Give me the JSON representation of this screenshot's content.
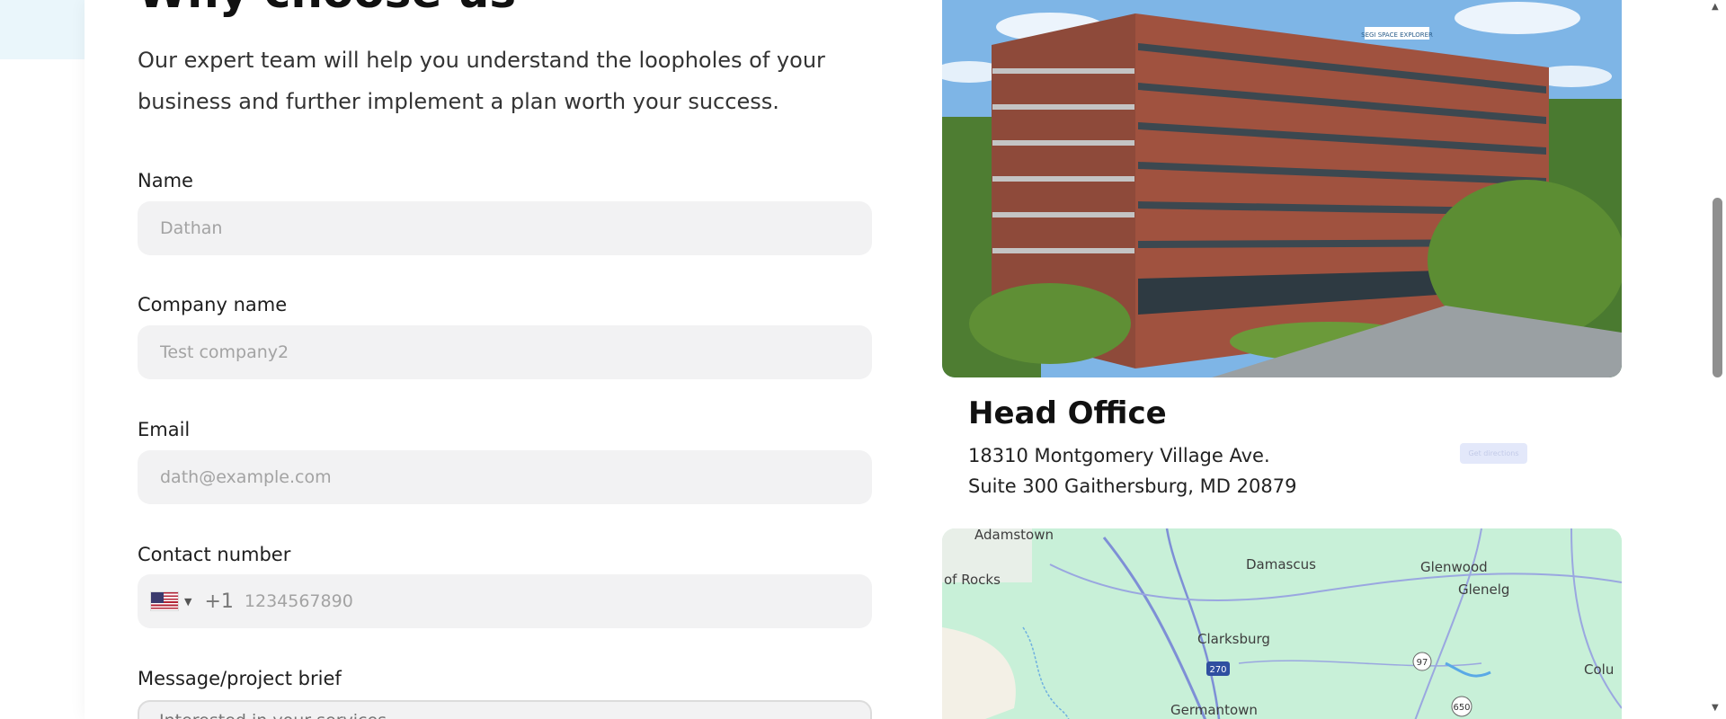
{
  "section": {
    "heading": "Why choose us",
    "intro": "Our expert team will help you understand the loopholes of your business and further implement a plan worth your success."
  },
  "form": {
    "name": {
      "label": "Name",
      "placeholder": "Dathan"
    },
    "company": {
      "label": "Company name",
      "placeholder": "Test company2"
    },
    "email": {
      "label": "Email",
      "placeholder": "dath@example.com"
    },
    "phone": {
      "label": "Contact number",
      "country_icon": "us-flag-icon",
      "dial_code": "+1",
      "placeholder": "1234567890"
    },
    "message": {
      "label": "Message/project brief",
      "placeholder": "Interested in your services"
    }
  },
  "office": {
    "title": "Head Office",
    "address_line1": "18310 Montgomery Village Ave.",
    "address_line2": "Suite 300 Gaithersburg, MD 20879",
    "directions_label": "Get directions",
    "building_sign": "SEGI    SPACE EXPLORER"
  },
  "map": {
    "places": [
      "Adamstown",
      "of Rocks",
      "Damascus",
      "Glenwood",
      "Glenelg",
      "Clarksburg",
      "Colu",
      "Germantown"
    ],
    "route_shields": [
      "270",
      "97",
      "650"
    ]
  },
  "colors": {
    "page_band": "#eaf6fb",
    "field_bg": "#f2f2f3",
    "map_green": "#c8f0d8",
    "brick": "#a0523f"
  }
}
